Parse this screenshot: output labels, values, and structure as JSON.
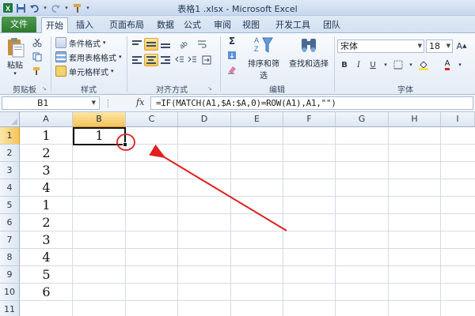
{
  "window": {
    "title": "表格1 .xlsx - Microsoft Excel",
    "qat_icons": [
      "excel-app-icon",
      "save-icon",
      "undo-icon",
      "redo-icon",
      "format-painter-icon"
    ]
  },
  "tabs": [
    "文件",
    "开始",
    "插入",
    "页面布局",
    "数据",
    "公式",
    "审阅",
    "视图",
    "开发工具",
    "团队"
  ],
  "active_tab": "开始",
  "ribbon": {
    "clipboard": {
      "paste": "粘贴",
      "label": "剪贴板"
    },
    "styles": {
      "conditional": "条件格式",
      "table_format": "套用表格格式",
      "cell_styles": "单元格样式",
      "label": "样式"
    },
    "alignment": {
      "label": "对齐方式"
    },
    "editing": {
      "sort": "排序和筛选",
      "find": "查找和选择",
      "label": "编辑"
    },
    "font": {
      "name": "宋体",
      "size": "18",
      "bold": "B",
      "italic": "I",
      "underline": "U",
      "font_color": "A",
      "label": "字体"
    }
  },
  "formula_bar": {
    "name_box": "B1",
    "fx": "fx",
    "formula": "=IF(MATCH(A1,$A:$A,0)=ROW(A1),A1,\"\")"
  },
  "grid": {
    "columns": [
      "A",
      "B",
      "C",
      "D",
      "E",
      "F",
      "G",
      "H",
      "I"
    ],
    "rows": [
      "1",
      "2",
      "3",
      "4",
      "5",
      "6",
      "7",
      "8",
      "9",
      "10",
      "11"
    ],
    "selected_cell": "B1",
    "col_a_values": [
      "1",
      "2",
      "3",
      "4",
      "1",
      "2",
      "3",
      "4",
      "5",
      "6",
      ""
    ],
    "b1_value": "1"
  },
  "colors": {
    "file_tab": "#2f7a31",
    "selection_highlight": "#f5c45a",
    "annotation_red": "#e02020"
  }
}
